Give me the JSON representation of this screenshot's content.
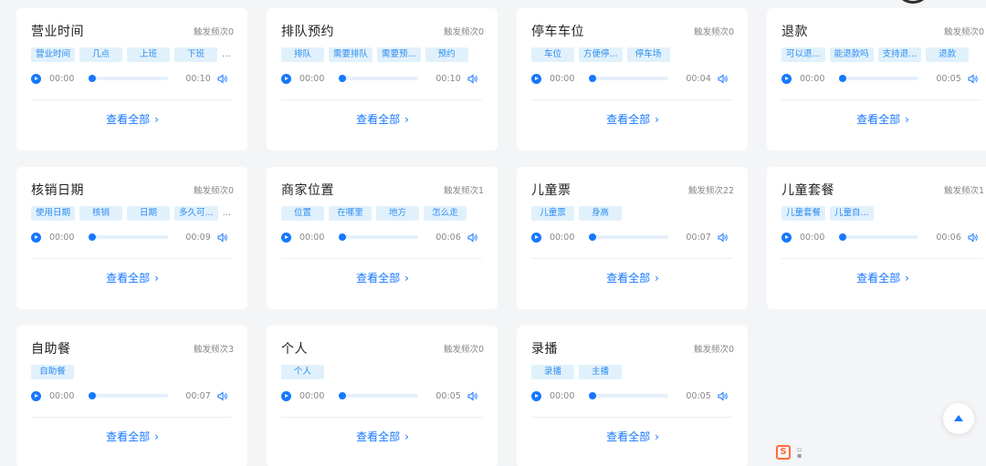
{
  "view_all_label": "查看全部",
  "cards": [
    {
      "title": "营业时间",
      "trigger": "触发频次0",
      "tags": [
        "营业时间",
        "几点",
        "上班",
        "下班"
      ],
      "more": "...",
      "current": "00:00",
      "duration": "00:10"
    },
    {
      "title": "排队预约",
      "trigger": "触发频次0",
      "tags": [
        "排队",
        "需要排队",
        "需要预...",
        "预约"
      ],
      "more": "",
      "current": "00:00",
      "duration": "00:10"
    },
    {
      "title": "停车车位",
      "trigger": "触发频次0",
      "tags": [
        "车位",
        "方便停...",
        "停车场"
      ],
      "more": "",
      "current": "00:00",
      "duration": "00:04"
    },
    {
      "title": "退款",
      "trigger": "触发频次0",
      "tags": [
        "可以退...",
        "能退款吗",
        "支持退...",
        "退款"
      ],
      "more": "",
      "current": "00:00",
      "duration": "00:05"
    },
    {
      "title": "核销日期",
      "trigger": "触发频次0",
      "tags": [
        "使用日期",
        "核销",
        "日期",
        "多久可..."
      ],
      "more": "...",
      "current": "00:00",
      "duration": "00:09"
    },
    {
      "title": "商家位置",
      "trigger": "触发频次1",
      "tags": [
        "位置",
        "在哪里",
        "地方",
        "怎么走"
      ],
      "more": "",
      "current": "00:00",
      "duration": "00:06"
    },
    {
      "title": "儿童票",
      "trigger": "触发频次22",
      "tags": [
        "儿童票",
        "身高"
      ],
      "more": "",
      "current": "00:00",
      "duration": "00:07"
    },
    {
      "title": "儿童套餐",
      "trigger": "触发频次1",
      "tags": [
        "儿童套餐",
        "儿童自..."
      ],
      "more": "",
      "current": "00:00",
      "duration": "00:06"
    },
    {
      "title": "自助餐",
      "trigger": "触发频次3",
      "tags": [
        "自助餐"
      ],
      "more": "",
      "current": "00:00",
      "duration": "00:07"
    },
    {
      "title": "个人",
      "trigger": "触发频次0",
      "tags": [
        "个人"
      ],
      "more": "",
      "current": "00:00",
      "duration": "00:05"
    },
    {
      "title": "录播",
      "trigger": "触发频次0",
      "tags": [
        "录播",
        "主播"
      ],
      "more": "",
      "current": "00:00",
      "duration": "00:05"
    }
  ],
  "colors": {
    "accent": "#1677ff",
    "tag_bg": "#e1f1fc",
    "page_bg": "#f4f5f7"
  },
  "icons": {
    "play": "play-icon",
    "volume": "volume-icon",
    "chevron": "chevron-right-icon",
    "back_to_top": "arrow-up-icon"
  },
  "logo_letter": "S"
}
